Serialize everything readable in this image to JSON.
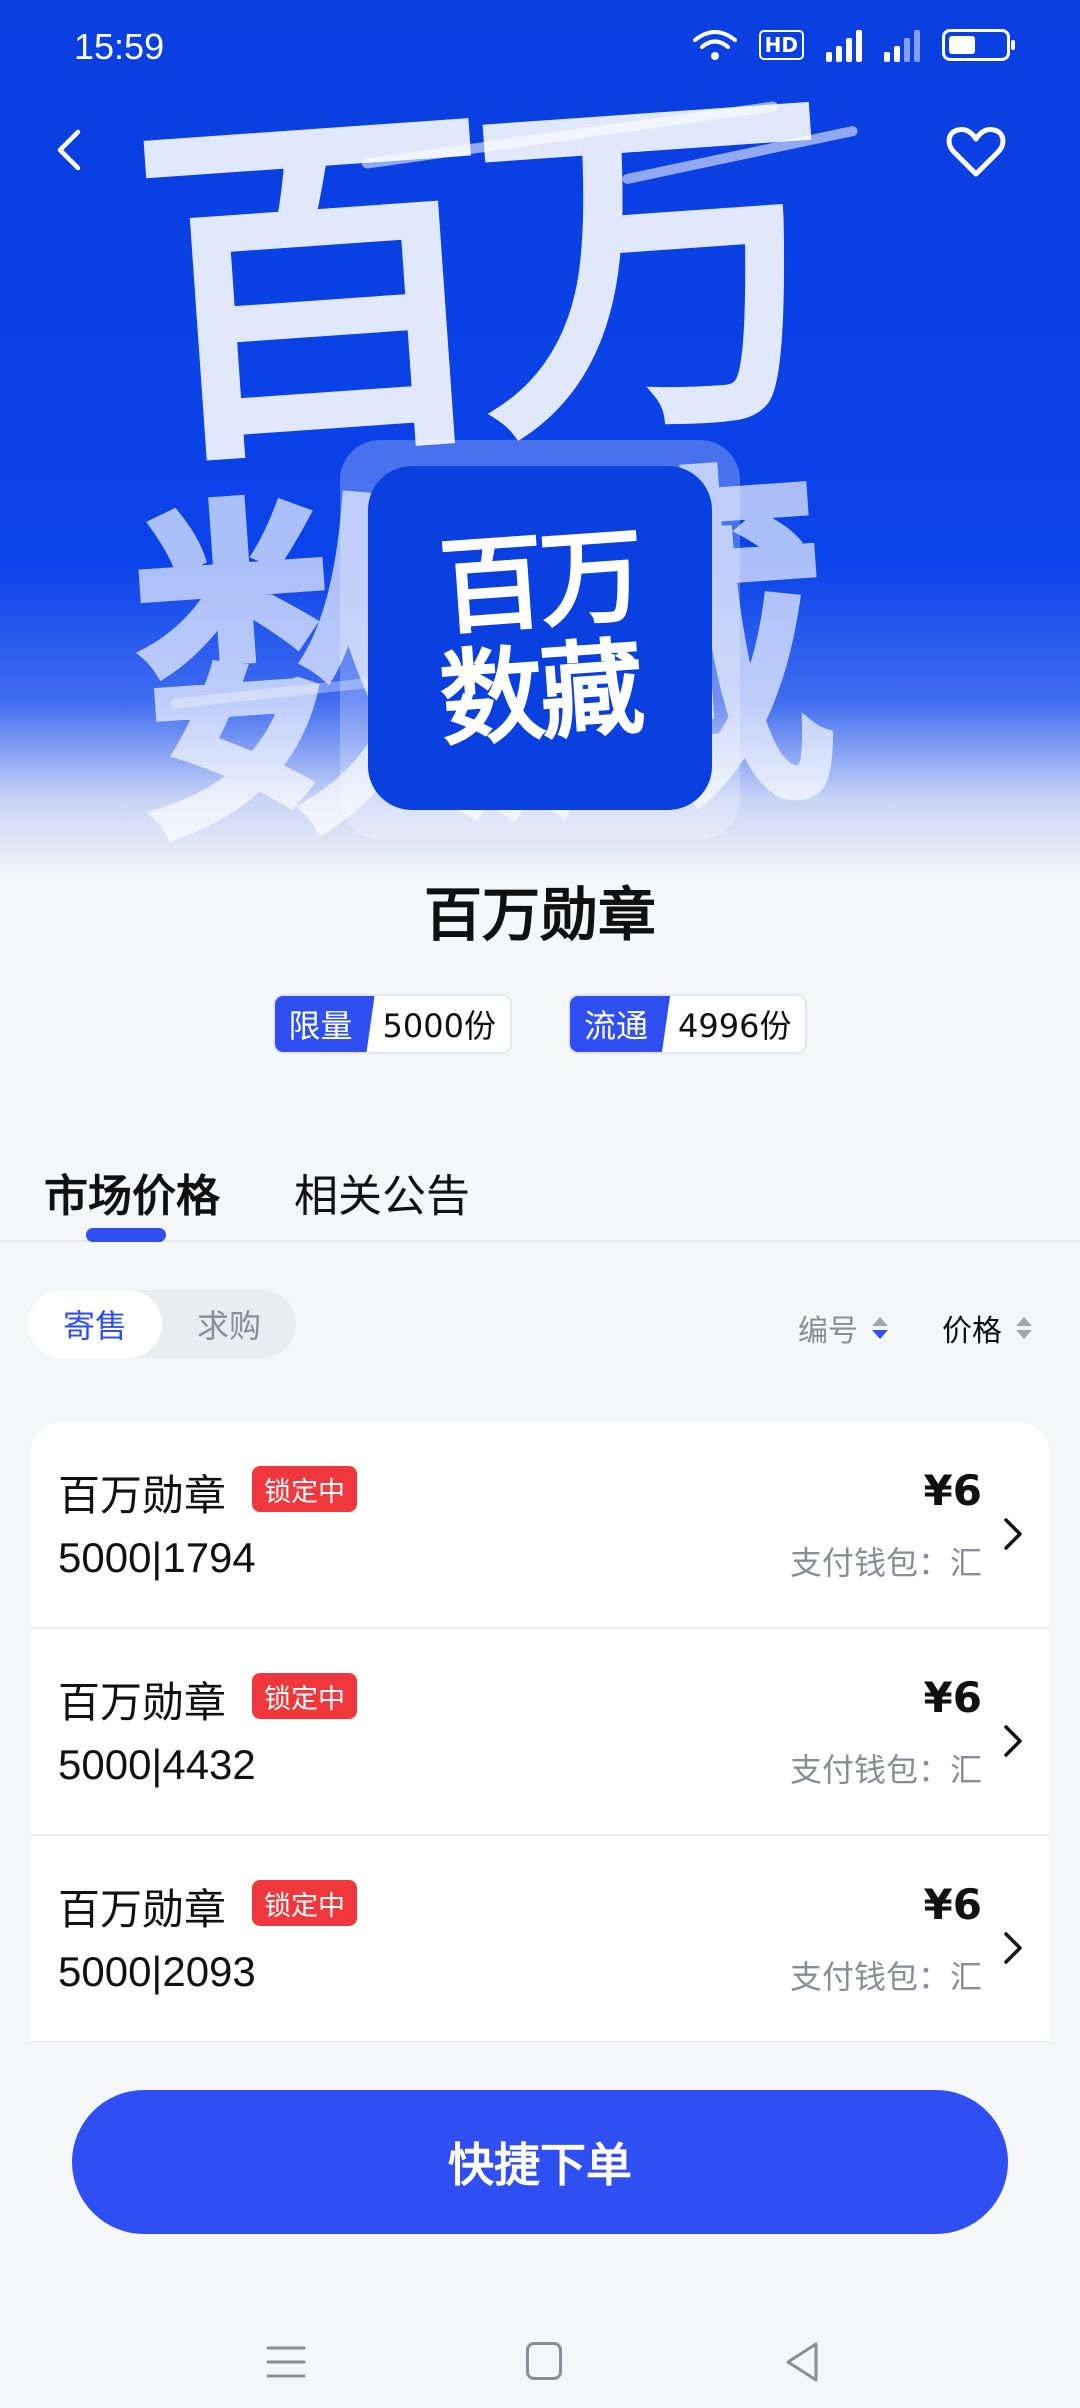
{
  "status_bar": {
    "time": "15:59",
    "hd": "HD",
    "net1": "4G",
    "net2": "4G"
  },
  "hero": {
    "bg_line1": "百万",
    "bg_line2": "数藏",
    "logo_line1": "百万",
    "logo_line2": "数藏"
  },
  "product": {
    "title": "百万勋章",
    "limit_label": "限量",
    "limit_value": "5000份",
    "circulation_label": "流通",
    "circulation_value": "4996份"
  },
  "tabs": [
    {
      "label": "市场价格"
    },
    {
      "label": "相关公告"
    }
  ],
  "filter": {
    "segments": [
      {
        "label": "寄售"
      },
      {
        "label": "求购"
      }
    ],
    "sort_number": "编号",
    "sort_price": "价格"
  },
  "listings": [
    {
      "name": "百万勋章",
      "badge": "锁定中",
      "serial": "5000|1794",
      "price": "¥6",
      "wallet": "支付钱包：汇"
    },
    {
      "name": "百万勋章",
      "badge": "锁定中",
      "serial": "5000|4432",
      "price": "¥6",
      "wallet": "支付钱包：汇"
    },
    {
      "name": "百万勋章",
      "badge": "锁定中",
      "serial": "5000|2093",
      "price": "¥6",
      "wallet": "支付钱包：汇"
    }
  ],
  "order_button": "快捷下单",
  "colors": {
    "accent": "#2f4ff2",
    "hero_blue": "#0a3fe0",
    "badge_red": "#f0373c"
  }
}
